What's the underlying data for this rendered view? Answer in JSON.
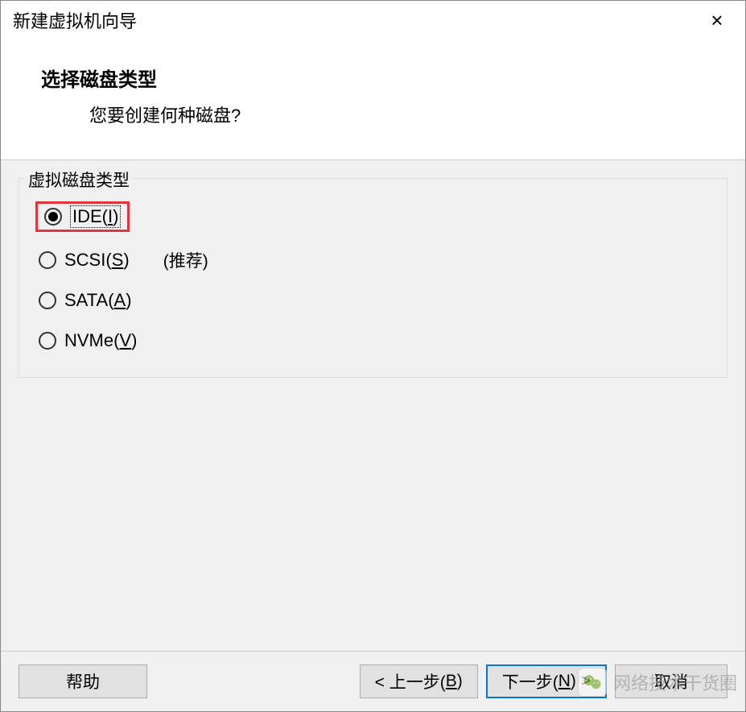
{
  "window": {
    "title": "新建虚拟机向导",
    "close_icon": "×"
  },
  "header": {
    "title": "选择磁盘类型",
    "subtitle": "您要创建何种磁盘?"
  },
  "fieldset": {
    "legend": "虚拟磁盘类型",
    "options": [
      {
        "label_prefix": "IDE(",
        "mnemonic": "I",
        "label_suffix": ")",
        "selected": true,
        "highlighted": true,
        "hint": ""
      },
      {
        "label_prefix": "SCSI(",
        "mnemonic": "S",
        "label_suffix": ")",
        "selected": false,
        "highlighted": false,
        "hint": "(推荐)"
      },
      {
        "label_prefix": "SATA(",
        "mnemonic": "A",
        "label_suffix": ")",
        "selected": false,
        "highlighted": false,
        "hint": ""
      },
      {
        "label_prefix": "NVMe(",
        "mnemonic": "V",
        "label_suffix": ")",
        "selected": false,
        "highlighted": false,
        "hint": ""
      }
    ]
  },
  "footer": {
    "help": "帮助",
    "back_prefix": "< 上一步(",
    "back_mnemonic": "B",
    "back_suffix": ")",
    "next_prefix": "下一步(",
    "next_mnemonic": "N",
    "next_suffix": ") >",
    "cancel": "取消"
  },
  "watermark": {
    "text": "网络技术干货圈"
  }
}
